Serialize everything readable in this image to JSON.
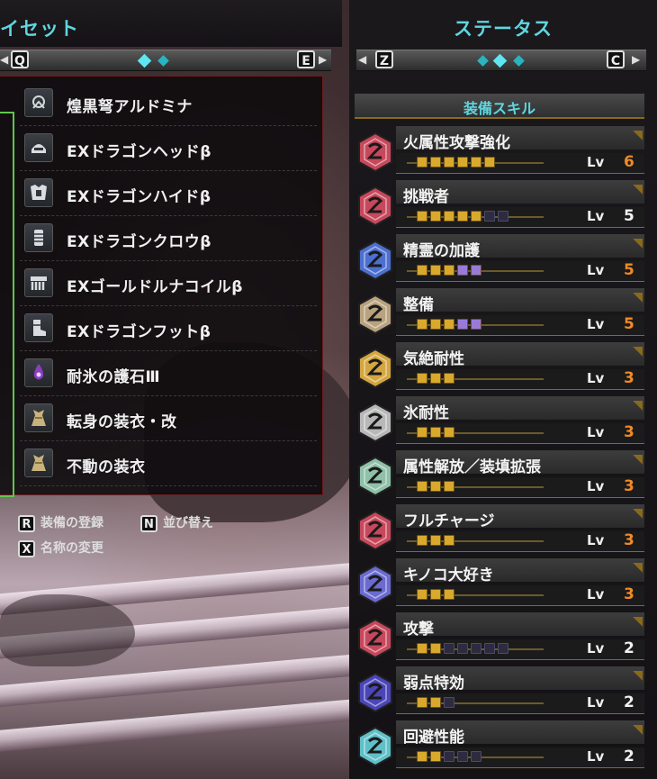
{
  "left": {
    "title": "イセット",
    "key_left": "Q",
    "key_right": "E",
    "items": [
      {
        "name": "煌黒弩アルドミナ",
        "icon": "crossbow-icon"
      },
      {
        "name": "EXドラゴンヘッドβ",
        "icon": "helm-icon"
      },
      {
        "name": "EXドラゴンハイドβ",
        "icon": "chest-armor-icon"
      },
      {
        "name": "EXドラゴンクロウβ",
        "icon": "arm-armor-icon"
      },
      {
        "name": "EXゴールドルナコイルβ",
        "icon": "waist-armor-icon"
      },
      {
        "name": "EXドラゴンフットβ",
        "icon": "leg-armor-icon"
      },
      {
        "name": "耐氷の護石Ⅲ",
        "icon": "charm-icon"
      },
      {
        "name": "転身の装衣・改",
        "icon": "mantle-icon"
      },
      {
        "name": "不動の装衣",
        "icon": "mantle-icon"
      }
    ],
    "actions": [
      {
        "key": "R",
        "label": "装備の登録"
      },
      {
        "key": "N",
        "label": "並び替え"
      },
      {
        "key": "X",
        "label": "名称の変更"
      }
    ]
  },
  "right": {
    "title": "ステータス",
    "key_left": "Z",
    "key_right": "C",
    "section": "装備スキル",
    "lv_label": "Lv",
    "skills": [
      {
        "name": "火属性攻撃強化",
        "level": 6,
        "max": 6,
        "color": "#c7485c",
        "maxed": true
      },
      {
        "name": "挑戦者",
        "level": 5,
        "max": 7,
        "color": "#c7485c",
        "maxed": false
      },
      {
        "name": "精霊の加護",
        "level": 5,
        "max": 5,
        "color": "#4d6fd0",
        "maxed": true
      },
      {
        "name": "整備",
        "level": 5,
        "max": 5,
        "color": "#b9a27e",
        "maxed": true
      },
      {
        "name": "気絶耐性",
        "level": 3,
        "max": 3,
        "color": "#d4a640",
        "maxed": true
      },
      {
        "name": "氷耐性",
        "level": 3,
        "max": 3,
        "color": "#b8b8b8",
        "maxed": true
      },
      {
        "name": "属性解放／装填拡張",
        "level": 3,
        "max": 3,
        "color": "#8fc0a8",
        "maxed": true
      },
      {
        "name": "フルチャージ",
        "level": 3,
        "max": 3,
        "color": "#c7485c",
        "maxed": true
      },
      {
        "name": "キノコ大好き",
        "level": 3,
        "max": 3,
        "color": "#6a6ad0",
        "maxed": true
      },
      {
        "name": "攻撃",
        "level": 2,
        "max": 7,
        "color": "#c7485c",
        "maxed": false
      },
      {
        "name": "弱点特効",
        "level": 2,
        "max": 3,
        "color": "#4b46b8",
        "maxed": false
      },
      {
        "name": "回避性能",
        "level": 2,
        "max": 5,
        "color": "#5fc0c8",
        "maxed": false
      }
    ]
  }
}
